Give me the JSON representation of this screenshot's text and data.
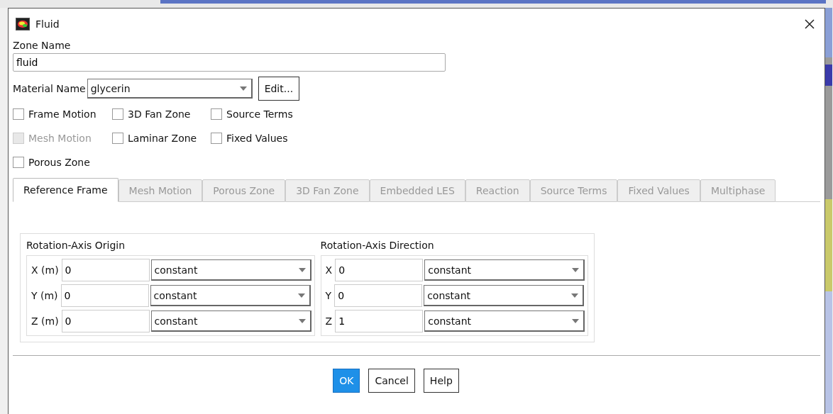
{
  "window": {
    "title": "Fluid"
  },
  "zone_name": {
    "label": "Zone Name",
    "value": "fluid"
  },
  "material": {
    "label": "Material Name",
    "value": "glycerin",
    "edit_button": "Edit..."
  },
  "options": [
    {
      "label": "Frame Motion",
      "checked": false,
      "disabled": false
    },
    {
      "label": "3D Fan Zone",
      "checked": false,
      "disabled": false
    },
    {
      "label": "Source Terms",
      "checked": false,
      "disabled": false
    },
    {
      "label": "Mesh Motion",
      "checked": false,
      "disabled": true
    },
    {
      "label": "Laminar Zone",
      "checked": false,
      "disabled": false
    },
    {
      "label": "Fixed Values",
      "checked": false,
      "disabled": false
    },
    {
      "label": "Porous Zone",
      "checked": false,
      "disabled": false
    }
  ],
  "tabs": [
    {
      "label": "Reference Frame",
      "selected": true
    },
    {
      "label": "Mesh Motion",
      "selected": false
    },
    {
      "label": "Porous Zone",
      "selected": false
    },
    {
      "label": "3D Fan Zone",
      "selected": false
    },
    {
      "label": "Embedded LES",
      "selected": false
    },
    {
      "label": "Reaction",
      "selected": false
    },
    {
      "label": "Source Terms",
      "selected": false
    },
    {
      "label": "Fixed Values",
      "selected": false
    },
    {
      "label": "Multiphase",
      "selected": false
    }
  ],
  "groups": [
    {
      "title": "Rotation-Axis Origin",
      "rows": [
        {
          "label": "X (m)",
          "value": "0",
          "method": "constant"
        },
        {
          "label": "Y (m)",
          "value": "0",
          "method": "constant"
        },
        {
          "label": "Z (m)",
          "value": "0",
          "method": "constant"
        }
      ]
    },
    {
      "title": "Rotation-Axis Direction",
      "rows": [
        {
          "label": "X",
          "value": "0",
          "method": "constant"
        },
        {
          "label": "Y",
          "value": "0",
          "method": "constant"
        },
        {
          "label": "Z",
          "value": "1",
          "method": "constant"
        }
      ]
    }
  ],
  "buttons": [
    {
      "label": "OK",
      "kind": "primary"
    },
    {
      "label": "Cancel",
      "kind": "normal"
    },
    {
      "label": "Help",
      "kind": "normal"
    }
  ]
}
